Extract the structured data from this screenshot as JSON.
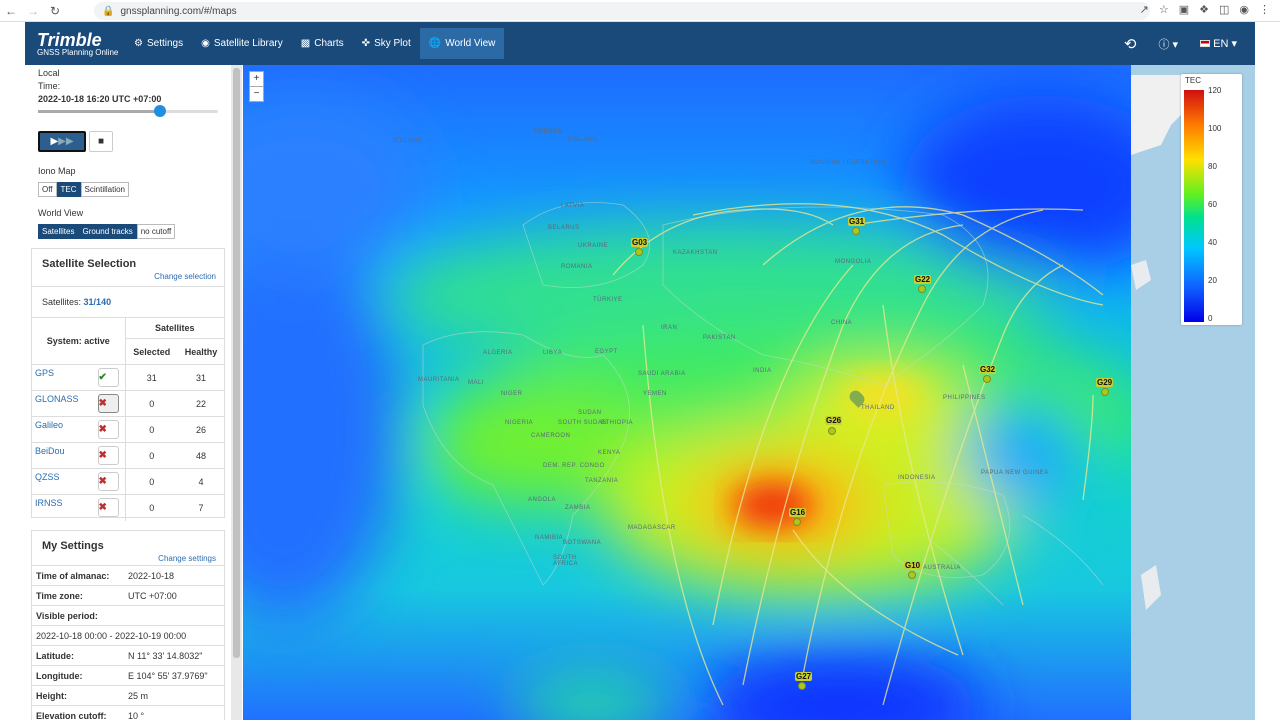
{
  "browser": {
    "url": "gnssplanning.com/#/maps"
  },
  "nav": {
    "logo_main": "Trimble",
    "logo_sub": "GNSS Planning Online",
    "items": [
      {
        "label": "Settings",
        "icon": "gear-icon"
      },
      {
        "label": "Satellite Library",
        "icon": "target-icon"
      },
      {
        "label": "Charts",
        "icon": "bar-chart-icon"
      },
      {
        "label": "Sky Plot",
        "icon": "crosshair-icon"
      },
      {
        "label": "World View",
        "icon": "globe-icon"
      }
    ],
    "lang": "EN"
  },
  "time": {
    "label1": "Local",
    "label2": "Time:",
    "value": "2022-10-18 16:20 UTC +07:00",
    "slider_fraction": 0.68
  },
  "iono": {
    "title": "Iono Map",
    "options": [
      "Off",
      "TEC",
      "Scintillation"
    ],
    "selected": "TEC"
  },
  "worldview": {
    "title": "World View",
    "options": [
      "Satellites",
      "Ground tracks",
      "no cutoff"
    ],
    "selected": [
      "Satellites",
      "Ground tracks"
    ]
  },
  "satsel": {
    "title": "Satellite Selection",
    "change": "Change selection",
    "count_label": "Satellites:",
    "count": "31/140",
    "col_system": "System: active",
    "col_sats": "Satellites",
    "col_selected": "Selected",
    "col_healthy": "Healthy",
    "systems": [
      {
        "name": "GPS",
        "active": true,
        "selected": "31",
        "healthy": "31"
      },
      {
        "name": "GLONASS",
        "active": false,
        "selected": "0",
        "healthy": "22"
      },
      {
        "name": "Galileo",
        "active": false,
        "selected": "0",
        "healthy": "26"
      },
      {
        "name": "BeiDou",
        "active": false,
        "selected": "0",
        "healthy": "48"
      },
      {
        "name": "QZSS",
        "active": false,
        "selected": "0",
        "healthy": "4"
      },
      {
        "name": "IRNSS",
        "active": false,
        "selected": "0",
        "healthy": "7"
      }
    ]
  },
  "mysettings": {
    "title": "My Settings",
    "change": "Change settings",
    "rows": [
      {
        "k": "Time of almanac:",
        "v": "2022-10-18"
      },
      {
        "k": "Time zone:",
        "v": "UTC +07:00"
      },
      {
        "k": "Visible period:",
        "v": ""
      },
      {
        "k": "",
        "v": "2022-10-18 00:00 - 2022-10-19 00:00"
      },
      {
        "k": "Latitude:",
        "v": "N 11° 33' 14.8032\""
      },
      {
        "k": "Longitude:",
        "v": "E 104° 55' 37.9769\""
      },
      {
        "k": "Height:",
        "v": "25 m"
      },
      {
        "k": "Elevation cutoff:",
        "v": "10 °"
      }
    ]
  },
  "legend": {
    "title": "TEC",
    "ticks": [
      "120",
      "100",
      "80",
      "60",
      "40",
      "20",
      "0"
    ]
  },
  "satellites": [
    "G03",
    "G31",
    "G22",
    "G32",
    "G29",
    "G26",
    "G16",
    "G10",
    "G27"
  ],
  "countries": [
    "ICELAND",
    "SWEDEN",
    "FINLAND",
    "RUSSIAN FEDERATION",
    "LATVIA",
    "BELARUS",
    "UKRAINE",
    "ROMANIA",
    "KAZAKHSTAN",
    "MONGOLIA",
    "TÜRKIYE",
    "IRAN",
    "CHINA",
    "PAKISTAN",
    "INDIA",
    "EGYPT",
    "LIBYA",
    "ALGERIA",
    "MAURITANIA",
    "MALI",
    "NIGER",
    "SAUDI ARABIA",
    "YEMEN",
    "NIGERIA",
    "SUDAN",
    "SOUTH SUDAN",
    "ETHIOPIA",
    "CAMEROON",
    "KENYA",
    "DEM. REP. CONGO",
    "TANZANIA",
    "ANGOLA",
    "ZAMBIA",
    "NAMIBIA",
    "BOTSWANA",
    "SOUTH AFRICA",
    "MADAGASCAR",
    "THAILAND",
    "PHILIPPINES",
    "PAPUA NEW GUINEA",
    "INDONESIA",
    "AUSTRALIA"
  ]
}
